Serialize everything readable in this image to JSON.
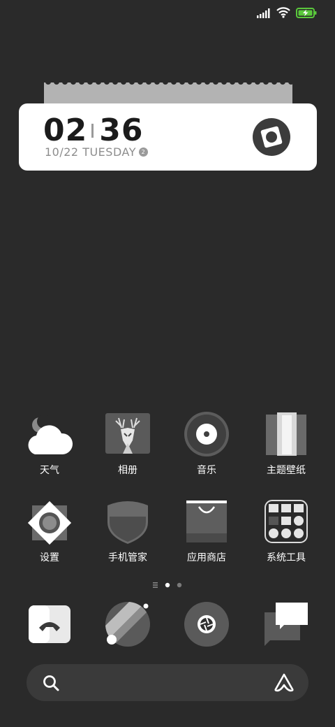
{
  "status_bar": {
    "signal_icon": "signal-icon",
    "wifi_icon": "wifi-icon",
    "battery_icon": "battery-charging-icon"
  },
  "clock_widget": {
    "hours": "02",
    "minutes": "36",
    "date": "10/22 TUESDAY",
    "badge": "2",
    "icon": "camera-shutter-icon"
  },
  "apps": [
    {
      "label": "天气",
      "icon": "weather-icon"
    },
    {
      "label": "相册",
      "icon": "gallery-icon"
    },
    {
      "label": "音乐",
      "icon": "music-icon"
    },
    {
      "label": "主题壁纸",
      "icon": "themes-icon"
    },
    {
      "label": "设置",
      "icon": "settings-icon"
    },
    {
      "label": "手机管家",
      "icon": "security-icon"
    },
    {
      "label": "应用商店",
      "icon": "app-store-icon"
    },
    {
      "label": "系统工具",
      "icon": "system-tools-folder-icon"
    }
  ],
  "page_indicator": {
    "pages": 3,
    "current": 2
  },
  "dock": [
    {
      "icon": "phone-icon"
    },
    {
      "icon": "browser-icon"
    },
    {
      "icon": "camera-icon"
    },
    {
      "icon": "messages-icon"
    }
  ],
  "search": {
    "left_icon": "search-icon",
    "right_icon": "assistant-icon"
  },
  "colors": {
    "background": "#2a2a2a",
    "accent_battery": "#5ac83c",
    "widget_bg": "#ffffff"
  }
}
